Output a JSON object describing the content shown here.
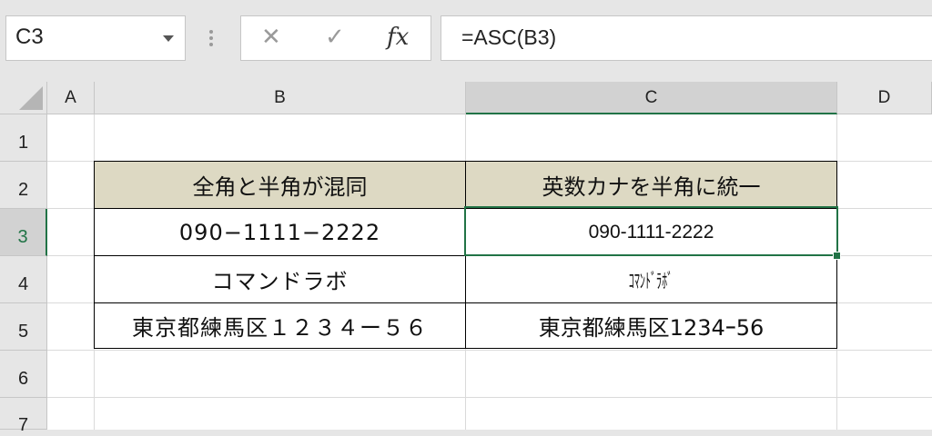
{
  "formula_bar": {
    "name_box": "C3",
    "cancel_icon": "✕",
    "enter_icon": "✓",
    "fx_label": "fx",
    "formula": "=ASC(B3)"
  },
  "columns": [
    "A",
    "B",
    "C",
    "D"
  ],
  "selected_column": "C",
  "rows": [
    "1",
    "2",
    "3",
    "4",
    "5",
    "6",
    "7"
  ],
  "selected_row": "3",
  "colors": {
    "header_fill": "#ddd9c3",
    "accent": "#217346"
  },
  "table": {
    "header_b": "全角と半角が混同",
    "header_c": "英数カナを半角に統一",
    "rows": [
      {
        "b": "090−1111−2222",
        "c": "090-1111-2222"
      },
      {
        "b": "コマンドラボ",
        "c": "ｺﾏﾝﾄﾞﾗﾎﾞ"
      },
      {
        "b": "東京都練馬区１２３４ー５６",
        "c": "東京都練馬区1234ｰ56"
      }
    ]
  }
}
